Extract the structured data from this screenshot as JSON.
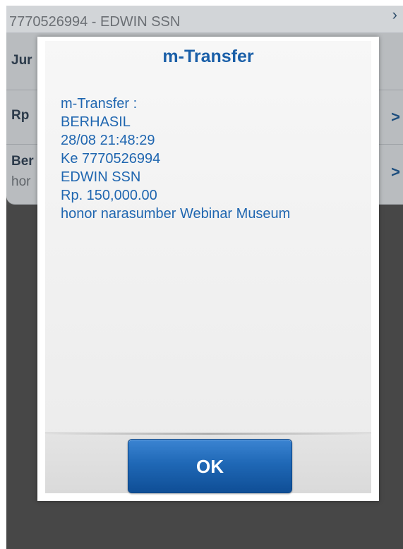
{
  "background": {
    "header_text": "7770526994 - EDWIN SSN",
    "rows": [
      {
        "label": "Jur",
        "sub": ""
      },
      {
        "label": "Rp",
        "sub": ""
      },
      {
        "label": "Ber",
        "sub": "hor"
      }
    ]
  },
  "dialog": {
    "title": "m-Transfer",
    "message_lines": [
      "m-Transfer :",
      "BERHASIL",
      "28/08 21:48:29",
      "Ke 7770526994",
      "EDWIN SSN",
      "Rp. 150,000.00",
      "honor narasumber Webinar Museum"
    ],
    "ok_label": "OK"
  },
  "colors": {
    "title": "#1a5fa8",
    "message": "#1f66b0",
    "button": "#1f68b6"
  },
  "icons": {
    "row_chevron": "chevron-right-icon"
  }
}
